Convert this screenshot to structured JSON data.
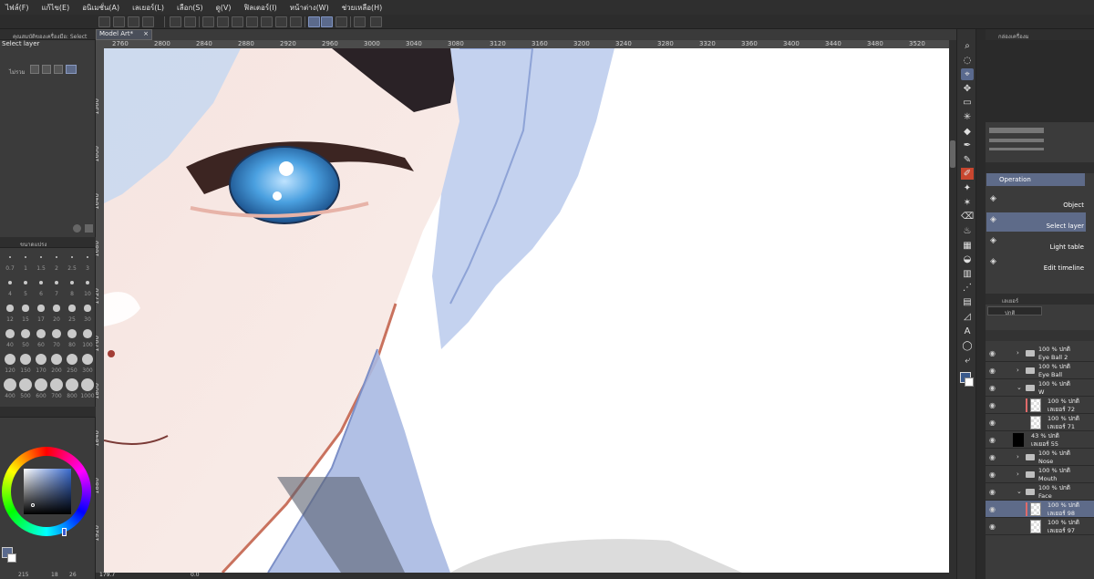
{
  "menu": [
    "ไฟล์(F)",
    "แก้ไข(E)",
    "อนิเมชั่น(A)",
    "เลเยอร์(L)",
    "เลือก(S)",
    "ดู(V)",
    "ฟิลเตอร์(I)",
    "หน้าต่าง(W)",
    "ช่วยเหลือ(H)"
  ],
  "left": {
    "tool_property_title": "คุณสมบัติของเครื่องมือ: Select",
    "tool_name": "Select layer",
    "mode_label": "ไม่รวม",
    "brush_size_title": "ขนาดแปรง",
    "brush_sizes": [
      "0.7",
      "1",
      "1.5",
      "2",
      "2.5",
      "3",
      "4",
      "5",
      "6",
      "7",
      "8",
      "10",
      "12",
      "15",
      "17",
      "20",
      "25",
      "30",
      "40",
      "50",
      "60",
      "70",
      "80",
      "100",
      "120",
      "150",
      "170",
      "200",
      "250",
      "300",
      "400",
      "500",
      "600",
      "700",
      "800",
      "1000"
    ],
    "color_hint": "color"
  },
  "document": {
    "tab_label": "Model Art*"
  },
  "rulers": {
    "h": [
      "2760",
      "2800",
      "2840",
      "2880",
      "2920",
      "2960",
      "3000",
      "3040",
      "3080",
      "3120",
      "3160",
      "3200",
      "3240",
      "3280",
      "3320",
      "3360",
      "3400",
      "3440",
      "3480",
      "3520"
    ],
    "v": [
      "1560",
      "1600",
      "1640",
      "1680",
      "1720",
      "1760",
      "1800",
      "1840",
      "1880",
      "1920",
      "1960"
    ]
  },
  "status": {
    "zoom": "179.7",
    "angle": "0.0"
  },
  "left_status": {
    "a": "215",
    "b": "18",
    "c": "26"
  },
  "right": {
    "nav_title": "กล่องเครื่องม",
    "operation_title": "Operation",
    "operations": [
      {
        "label": "Object",
        "icon": "object-icon",
        "selected": false
      },
      {
        "label": "Select layer",
        "icon": "select-layer-icon",
        "selected": true
      },
      {
        "label": "Light table",
        "icon": "light-table-icon",
        "selected": false
      },
      {
        "label": "Edit timeline",
        "icon": "timeline-icon",
        "selected": false
      }
    ],
    "layer_title": "เลเยอร์",
    "blend_mode": "ปกติ",
    "layers": [
      {
        "type": "folder",
        "line1": "100 % ปกติ",
        "line2": "Eye Ball 2"
      },
      {
        "type": "folder",
        "line1": "100 % ปกติ",
        "line2": "Eye Ball"
      },
      {
        "type": "folder-open",
        "line1": "100 % ปกติ",
        "line2": "W"
      },
      {
        "type": "raster",
        "line1": "100 % ปกติ",
        "line2": "เลเยอร์ 72"
      },
      {
        "type": "raster",
        "line1": "100 % ปกติ",
        "line2": "เลเยอร์ 71"
      },
      {
        "type": "black",
        "line1": "43 % ปกติ",
        "line2": "เลเยอร์ 55"
      },
      {
        "type": "folder",
        "line1": "100 % ปกติ",
        "line2": "Nose"
      },
      {
        "type": "folder",
        "line1": "100 % ปกติ",
        "line2": "Mouth"
      },
      {
        "type": "folder-open",
        "line1": "100 % ปกติ",
        "line2": "Face"
      },
      {
        "type": "raster",
        "line1": "100 % ปกติ",
        "line2": "เลเยอร์ 98",
        "selected": true
      },
      {
        "type": "raster",
        "line1": "100 % ปกติ",
        "line2": "เลเยอร์ 97"
      }
    ]
  }
}
